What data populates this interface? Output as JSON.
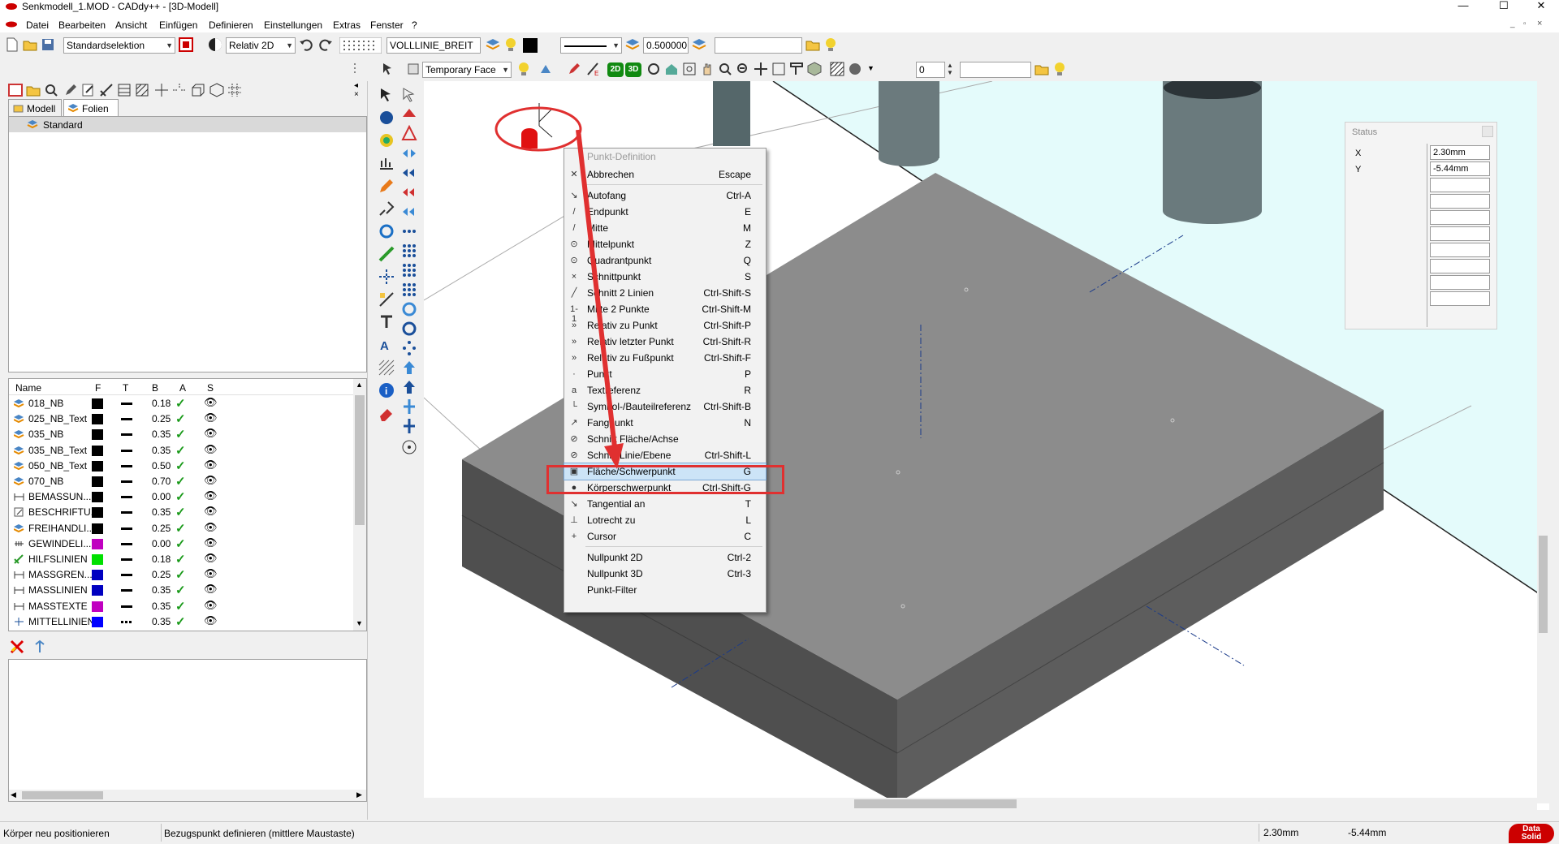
{
  "window": {
    "title": "Senkmodell_1.MOD  -  CADdy++ - [3D-Modell]",
    "minimize": "—",
    "maximize": "☐",
    "close": "✕"
  },
  "menu": [
    "Datei",
    "Bearbeiten",
    "Ansicht",
    "Einfügen",
    "Definieren",
    "Einstellungen",
    "Extras",
    "Fenster",
    "?"
  ],
  "toolbar1": {
    "selection_mode": "Standardselektion",
    "coord_mode": "Relativ 2D",
    "line_type": "VOLLLINIE_BREIT",
    "line_width": "0.500000",
    "text_field": ""
  },
  "toolbar2": {
    "face_mode": "Temporary Face",
    "btn_2d": "2D",
    "btn_3d": "3D",
    "counter": "0",
    "text_field": ""
  },
  "left_panel": {
    "tabs": [
      "Modell",
      "Folien"
    ],
    "tree_item": "Standard",
    "layer_columns": [
      "Name",
      "F",
      "T",
      "B",
      "A",
      "S"
    ],
    "layers": [
      {
        "name": "018_NB",
        "color": "#000000",
        "width": "0.18",
        "icon": "layer"
      },
      {
        "name": "025_NB_Text",
        "color": "#000000",
        "width": "0.25",
        "icon": "layer"
      },
      {
        "name": "035_NB",
        "color": "#000000",
        "width": "0.35",
        "icon": "layer"
      },
      {
        "name": "035_NB_Text",
        "color": "#000000",
        "width": "0.35",
        "icon": "layer"
      },
      {
        "name": "050_NB_Text",
        "color": "#000000",
        "width": "0.50",
        "icon": "layer"
      },
      {
        "name": "070_NB",
        "color": "#000000",
        "width": "0.70",
        "icon": "layer"
      },
      {
        "name": "BEMASSUN...",
        "color": "#000000",
        "width": "0.00",
        "icon": "dimension"
      },
      {
        "name": "BESCHRIFTU...",
        "color": "#000000",
        "width": "0.35",
        "icon": "text"
      },
      {
        "name": "FREIHANDLI...",
        "color": "#000000",
        "width": "0.25",
        "icon": "layer"
      },
      {
        "name": "GEWINDELI...",
        "color": "#c000c0",
        "width": "0.00",
        "icon": "thread"
      },
      {
        "name": "HILFSLINIEN",
        "color": "#00e000",
        "width": "0.18",
        "icon": "aux"
      },
      {
        "name": "MASSGREN...",
        "color": "#0000c0",
        "width": "0.25",
        "icon": "dimension"
      },
      {
        "name": "MASSLINIEN",
        "color": "#0000c0",
        "width": "0.35",
        "icon": "dimension"
      },
      {
        "name": "MASSTEXTE",
        "color": "#c000c0",
        "width": "0.35",
        "icon": "dimension"
      },
      {
        "name": "MITTELLINIEN",
        "color": "#0000ff",
        "width": "0.35",
        "icon": "center",
        "dashed": true
      }
    ]
  },
  "context_menu": {
    "header": "Punkt-Definition",
    "items": [
      {
        "label": "Abbrechen",
        "key": "Escape"
      },
      {
        "label": "Autofang",
        "key": "Ctrl-A"
      },
      {
        "label": "Endpunkt",
        "key": "E"
      },
      {
        "label": "Mitte",
        "key": "M"
      },
      {
        "label": "Mittelpunkt",
        "key": "Z"
      },
      {
        "label": "Quadrantpunkt",
        "key": "Q"
      },
      {
        "label": "Schnittpunkt",
        "key": "S"
      },
      {
        "label": "Schnitt 2 Linien",
        "key": "Ctrl-Shift-S"
      },
      {
        "label": "Mitte 2 Punkte",
        "key": "Ctrl-Shift-M"
      },
      {
        "label": "Relativ zu Punkt",
        "key": "Ctrl-Shift-P"
      },
      {
        "label": "Relativ letzter Punkt",
        "key": "Ctrl-Shift-R"
      },
      {
        "label": "Relativ zu Fußpunkt",
        "key": "Ctrl-Shift-F"
      },
      {
        "label": "Punkt",
        "key": "P"
      },
      {
        "label": "Textreferenz",
        "key": "R"
      },
      {
        "label": "Symbol-/Bauteilreferenz",
        "key": "Ctrl-Shift-B"
      },
      {
        "label": "Fangpunkt",
        "key": "N"
      },
      {
        "label": "Schnitt Fläche/Achse",
        "key": ""
      },
      {
        "label": "Schnitt Linie/Ebene",
        "key": "Ctrl-Shift-L"
      },
      {
        "label": "Fläche/Schwerpunkt",
        "key": "G"
      },
      {
        "label": "Körperschwerpunkt",
        "key": "Ctrl-Shift-G"
      },
      {
        "label": "Tangential an",
        "key": "T"
      },
      {
        "label": "Lotrecht zu",
        "key": "L"
      },
      {
        "label": "Cursor",
        "key": "C"
      },
      {
        "label": "Nullpunkt 2D",
        "key": "Ctrl-2"
      },
      {
        "label": "Nullpunkt 3D",
        "key": "Ctrl-3"
      },
      {
        "label": "Punkt-Filter",
        "key": ""
      }
    ]
  },
  "status_window": {
    "title": "Status",
    "x_label": "X",
    "x_value": "2.30mm",
    "y_label": "Y",
    "y_value": "-5.44mm"
  },
  "statusbar": {
    "left": "Körper neu positionieren",
    "middle": "Bezugspunkt definieren (mittlere Maustaste)",
    "x": "2.30mm",
    "y": "-5.44mm",
    "logo_top": "Data",
    "logo_bottom": "Solid"
  },
  "colors": {
    "highlight_red": "#e03030",
    "selected_item": "#cce4f7",
    "box_top": "#8c8c8c",
    "box_side": "#555555",
    "cyan_plane": "#e4fbfb"
  }
}
